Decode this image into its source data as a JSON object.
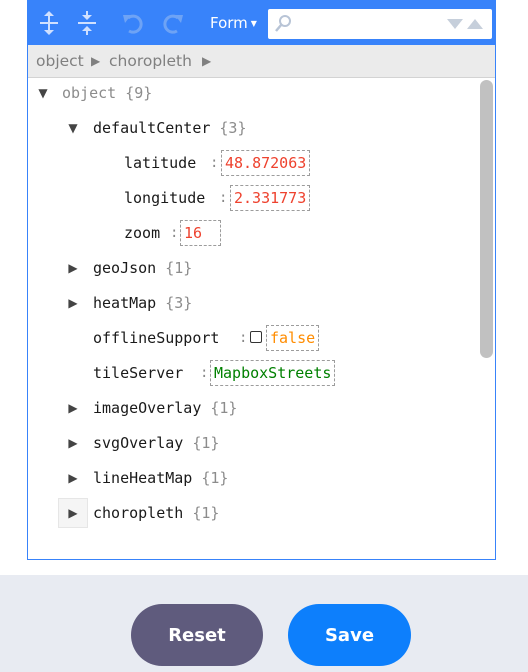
{
  "toolbar": {
    "expand_all_icon": "expand-all-icon",
    "collapse_all_icon": "collapse-all-icon",
    "undo_icon": "undo-icon",
    "redo_icon": "redo-icon",
    "mode_label": "Form",
    "search_placeholder": ""
  },
  "breadcrumb": [
    "object",
    "choropleth"
  ],
  "tree": {
    "root": {
      "name": "object",
      "count": "{9}"
    },
    "defaultCenter": {
      "name": "defaultCenter",
      "count": "{3}"
    },
    "latitude": {
      "name": "latitude",
      "value": "48.872063"
    },
    "longitude": {
      "name": "longitude",
      "value": "2.331773"
    },
    "zoom": {
      "name": "zoom",
      "value": "16"
    },
    "geoJson": {
      "name": "geoJson",
      "count": "{1}"
    },
    "heatMap": {
      "name": "heatMap",
      "count": "{3}"
    },
    "offlineSupport": {
      "name": "offlineSupport",
      "value": "false"
    },
    "tileServer": {
      "name": "tileServer",
      "value": "MapboxStreets"
    },
    "imageOverlay": {
      "name": "imageOverlay",
      "count": "{1}"
    },
    "svgOverlay": {
      "name": "svgOverlay",
      "count": "{1}"
    },
    "lineHeatMap": {
      "name": "lineHeatMap",
      "count": "{1}"
    },
    "choropleth": {
      "name": "choropleth",
      "count": "{1}"
    }
  },
  "separator": ":",
  "buttons": {
    "reset": "Reset",
    "save": "Save"
  },
  "colors": {
    "accent": "#3883fa",
    "number": "#ee422e",
    "boolean": "#ff8c00",
    "string": "#008000",
    "reset_button": "#5f5b7d",
    "save_button": "#0d7ffc"
  }
}
